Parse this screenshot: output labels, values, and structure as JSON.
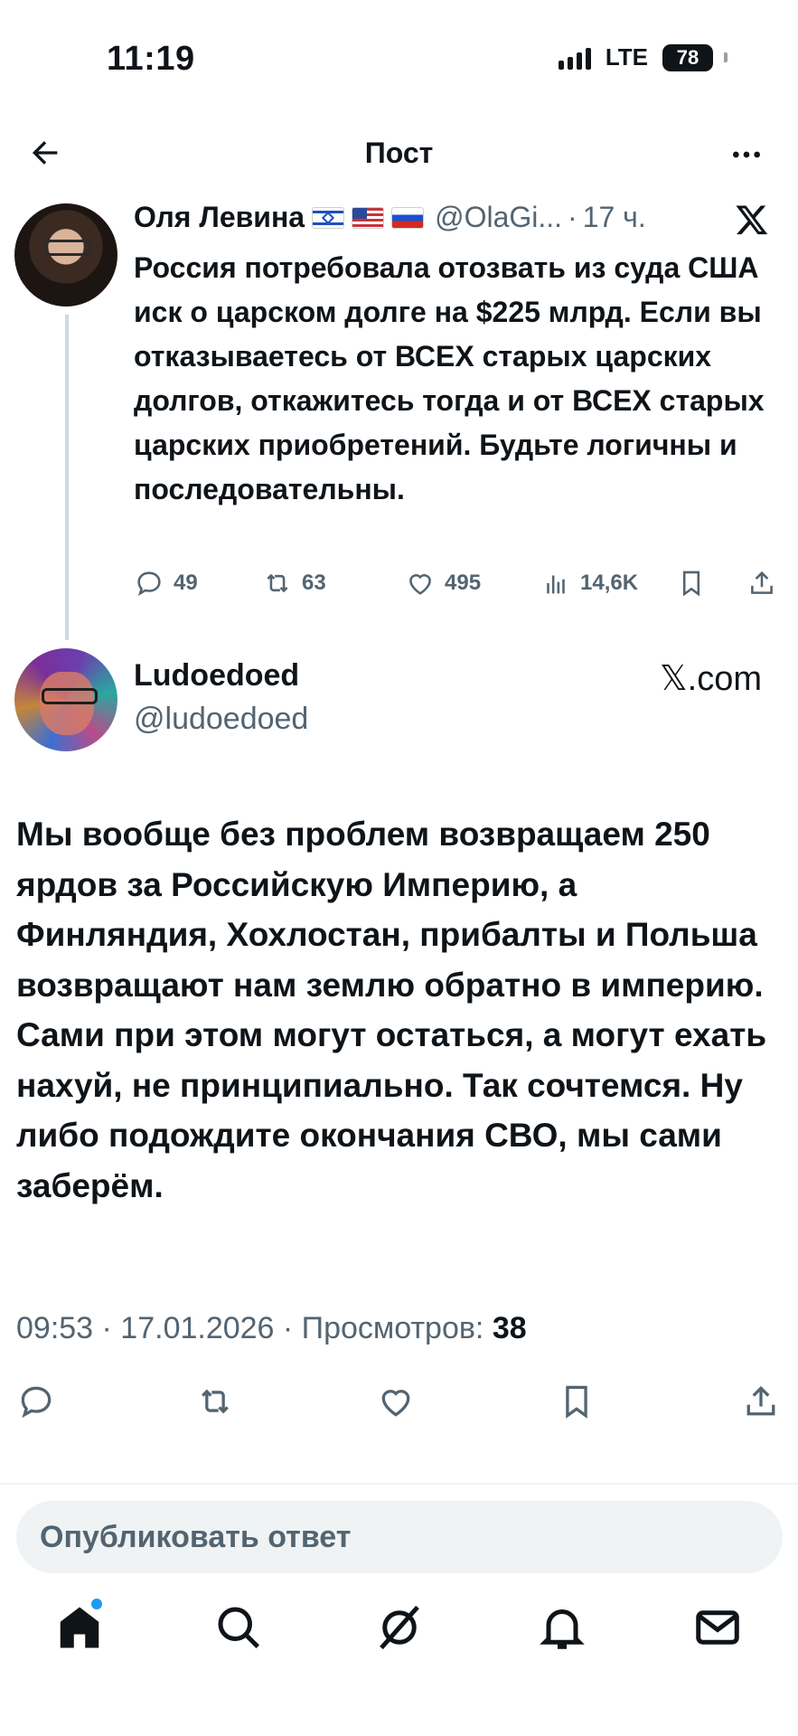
{
  "status_bar": {
    "time": "11:19",
    "network": "LTE",
    "battery": "78"
  },
  "header": {
    "title": "Пост"
  },
  "quoted_tweet": {
    "author_name": "Оля Левина",
    "flags": [
      "israel-flag",
      "usa-flag",
      "russia-flag"
    ],
    "handle": "@OlaGi...",
    "separator": "·",
    "time": "17 ч.",
    "text": "Россия потребовала отозвать из суда США иск о царском долге на $225 млрд. Если вы отказываетесь от ВСЕХ старых царских долгов, откажитесь тогда и от ВСЕХ старых царских приобретений. Будьте логичны и последовательны.",
    "stats": {
      "replies": "49",
      "reposts": "63",
      "likes": "495",
      "views": "14,6K"
    }
  },
  "main_tweet": {
    "author_name": "Ludoedoed",
    "handle": "@ludoedoed",
    "source_label": "𝕏.com",
    "text": "Мы вообще без проблем возвращаем 250 ярдов за Российскую Империю, а Финляндия, Хохлостан, прибалты и Польша возвращают нам землю обратно в империю. Сами при этом могут остаться, а могут ехать нахуй, не принципиально. Так сочтемся. Ну либо подождите окончания СВО, мы сами заберём.",
    "timestamp": "09:53 · 17.01.2026 · Просмотров:",
    "views": "38"
  },
  "reply": {
    "placeholder": "Опубликовать ответ"
  },
  "tab_bar": {
    "items": [
      "home-icon",
      "search-icon",
      "grok-icon",
      "notifications-icon",
      "messages-icon"
    ],
    "accent": "#1d9bf0"
  }
}
